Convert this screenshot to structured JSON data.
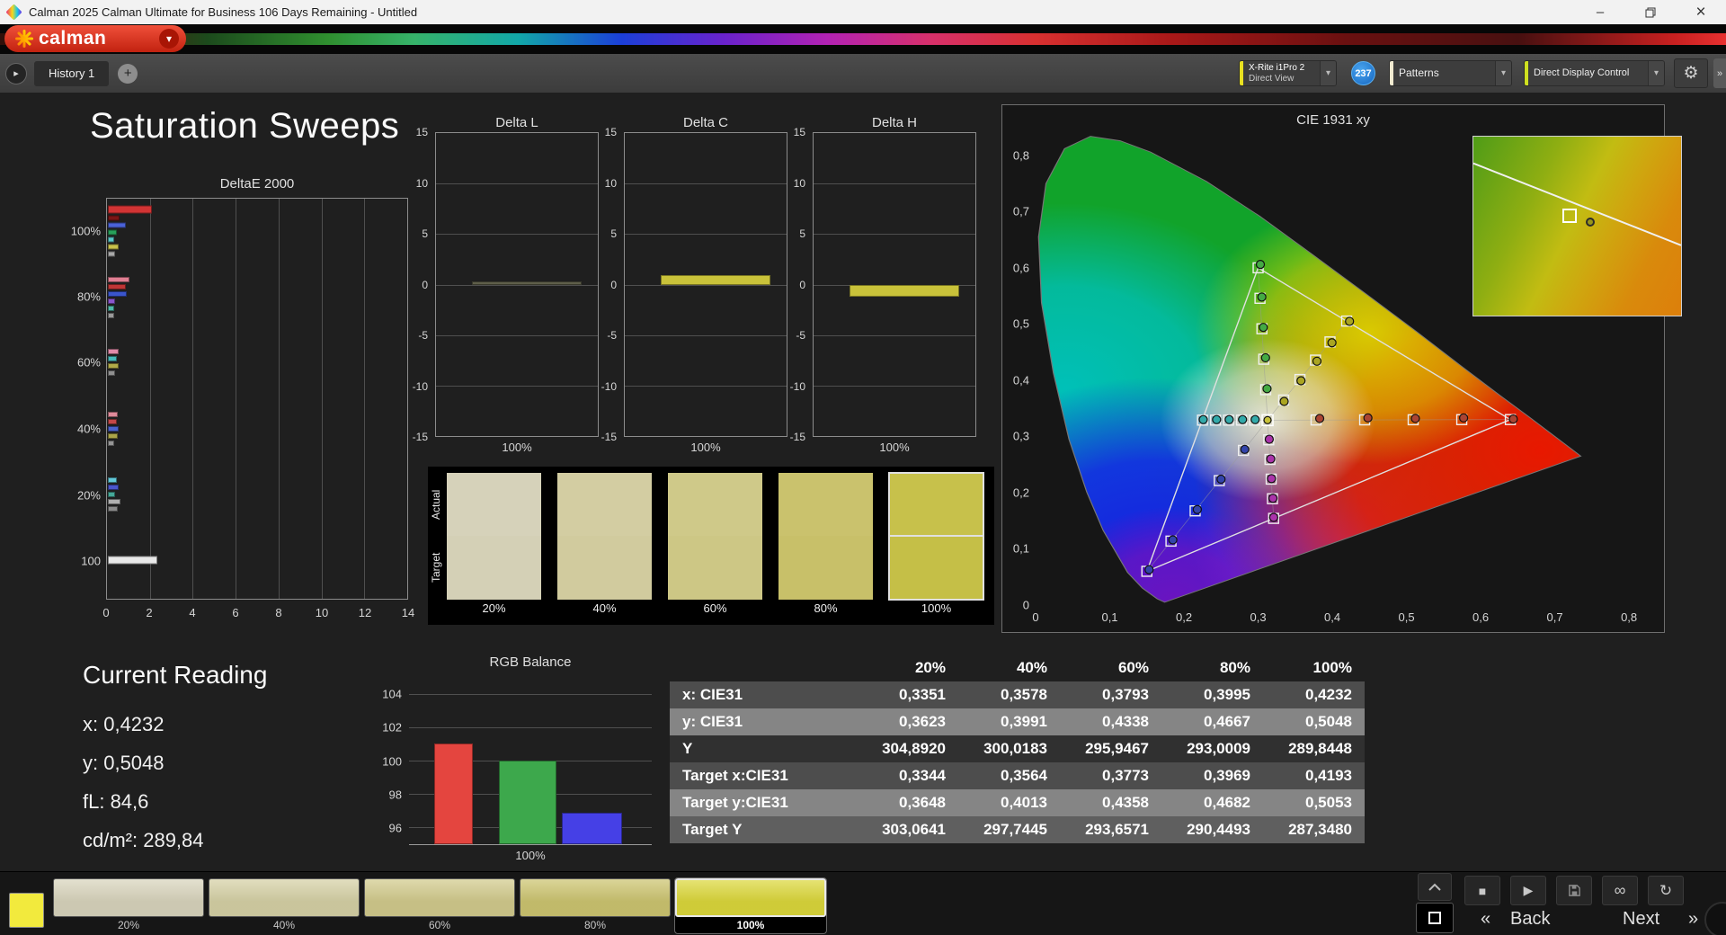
{
  "window": {
    "title": "Calman 2025 Calman Ultimate for Business 106 Days Remaining  - Untitled",
    "brand_logo": "calman"
  },
  "icons": {
    "minimize": "–",
    "close": "×",
    "dropdown_arrow": "▾",
    "tab_scroll": "▸",
    "add_tab": "+",
    "gear": "⚙",
    "edge_more": "»",
    "stop": "■",
    "play": "▶",
    "link": "∞",
    "refresh": "↻",
    "back_chevron": "«",
    "next_chevron": "»"
  },
  "workspace_tabs": {
    "active_tab": "History 1"
  },
  "toolbar": {
    "meter": {
      "line1": "X-Rite i1Pro 2",
      "line2": "Direct View"
    },
    "meter_badge": "237",
    "patterns_label": "Patterns",
    "display_control_label": "Direct Display Control"
  },
  "page": {
    "title": "Saturation Sweeps"
  },
  "current_reading": {
    "title": "Current Reading",
    "x": "x: 0,4232",
    "y": "y: 0,5048",
    "fl": "fL: 84,6",
    "cdm2": "cd/m²: 289,84"
  },
  "bottom_bar": {
    "active_color": "#f2ea3d",
    "swatches": [
      {
        "label": "20%",
        "color": "#d9d5bd"
      },
      {
        "label": "40%",
        "color": "#d6d1a6"
      },
      {
        "label": "60%",
        "color": "#d2cb8d"
      },
      {
        "label": "80%",
        "color": "#cdc571"
      },
      {
        "label": "100%",
        "color": "#dcd83c",
        "selected": true
      }
    ],
    "back_label": "Back",
    "next_label": "Next"
  },
  "chart_data": [
    {
      "id": "deltae2000",
      "type": "bar",
      "orientation": "horizontal",
      "title": "DeltaE 2000",
      "xlim": [
        0,
        14
      ],
      "x_ticks": [
        0,
        2,
        4,
        6,
        8,
        10,
        12,
        14
      ],
      "groups": [
        {
          "label": "100%",
          "center_pct": 8.2,
          "bars": [
            {
              "color": "#d23434",
              "value": 2.05,
              "thick": true
            },
            {
              "color": "#7a1515",
              "value": 0.55
            },
            {
              "color": "#4a62d8",
              "value": 0.85
            },
            {
              "color": "#27a05a",
              "value": 0.4
            },
            {
              "color": "#58c8c8",
              "value": 0.3
            },
            {
              "color": "#c8c24a",
              "value": 0.5
            },
            {
              "color": "#a8a8a8",
              "value": 0.35
            }
          ]
        },
        {
          "label": "80%",
          "center_pct": 24.7,
          "bars": [
            {
              "color": "#e07f92",
              "value": 1.0
            },
            {
              "color": "#c03535",
              "value": 0.85
            },
            {
              "color": "#3a55cc",
              "value": 0.9
            },
            {
              "color": "#8a55cc",
              "value": 0.35
            },
            {
              "color": "#4fb8a8",
              "value": 0.3
            },
            {
              "color": "#9a9a9a",
              "value": 0.3
            }
          ]
        },
        {
          "label": "60%",
          "center_pct": 41.0,
          "bars": [
            {
              "color": "#e08aa8",
              "value": 0.5
            },
            {
              "color": "#45b8b8",
              "value": 0.4
            },
            {
              "color": "#b0aa48",
              "value": 0.5
            },
            {
              "color": "#8f8f8f",
              "value": 0.35
            }
          ]
        },
        {
          "label": "40%",
          "center_pct": 57.5,
          "bars": [
            {
              "color": "#e08a9a",
              "value": 0.45
            },
            {
              "color": "#c44848",
              "value": 0.4
            },
            {
              "color": "#4a62cc",
              "value": 0.5
            },
            {
              "color": "#aaa448",
              "value": 0.45
            },
            {
              "color": "#959595",
              "value": 0.3
            }
          ]
        },
        {
          "label": "20%",
          "center_pct": 74.0,
          "bars": [
            {
              "color": "#62c8d8",
              "value": 0.4
            },
            {
              "color": "#4a55cc",
              "value": 0.5
            },
            {
              "color": "#45a898",
              "value": 0.35
            },
            {
              "color": "#b0b0b0",
              "value": 0.6
            },
            {
              "color": "#8a8a8a",
              "value": 0.45
            }
          ]
        },
        {
          "label": "100",
          "center_pct": 90.4,
          "bars": [
            {
              "color": "#e8e8e8",
              "value": 2.3,
              "thick": true
            }
          ]
        }
      ]
    },
    {
      "id": "delta_l",
      "type": "bar",
      "title": "Delta L",
      "ylim": [
        -15,
        15
      ],
      "y_ticks": [
        15,
        10,
        5,
        0,
        -5,
        -10,
        -15
      ],
      "xlabel": "100%",
      "value": 0.3,
      "color": "#5e5e4a"
    },
    {
      "id": "delta_c",
      "type": "bar",
      "title": "Delta C",
      "ylim": [
        -15,
        15
      ],
      "y_ticks": [
        15,
        10,
        5,
        0,
        -5,
        -10,
        -15
      ],
      "xlabel": "100%",
      "value": 0.9,
      "color": "#c9c23a"
    },
    {
      "id": "delta_h",
      "type": "bar",
      "title": "Delta H",
      "ylim": [
        -15,
        15
      ],
      "y_ticks": [
        15,
        10,
        5,
        0,
        -5,
        -10,
        -15
      ],
      "xlabel": "100%",
      "value": -1.2,
      "color": "#c9c23a"
    },
    {
      "id": "rgb_balance",
      "type": "bar",
      "title": "RGB Balance",
      "ylim": [
        95,
        105
      ],
      "y_ticks": [
        104,
        102,
        100,
        98,
        96
      ],
      "xlabel": "100%",
      "series": [
        {
          "name": "Red",
          "value": 101.0,
          "color": "#e4453f"
        },
        {
          "name": "Green",
          "value": 100.0,
          "color": "#3da84c"
        },
        {
          "name": "Blue",
          "value": 96.9,
          "color": "#4540e6"
        }
      ]
    },
    {
      "id": "cie1931",
      "type": "scatter",
      "title": "CIE 1931 xy",
      "xlim": [
        0,
        0.8
      ],
      "ylim": [
        0,
        0.8
      ],
      "axis_max": 0.835,
      "x_ticks": [
        {
          "v": 0,
          "label": "0"
        },
        {
          "v": 0.1,
          "label": "0,1"
        },
        {
          "v": 0.2,
          "label": "0,2"
        },
        {
          "v": 0.3,
          "label": "0,3"
        },
        {
          "v": 0.4,
          "label": "0,4"
        },
        {
          "v": 0.5,
          "label": "0,5"
        },
        {
          "v": 0.6,
          "label": "0,6"
        },
        {
          "v": 0.7,
          "label": "0,7"
        },
        {
          "v": 0.8,
          "label": "0,8"
        }
      ],
      "y_ticks": [
        {
          "v": 0,
          "label": "0"
        },
        {
          "v": 0.1,
          "label": "0,1"
        },
        {
          "v": 0.2,
          "label": "0,2"
        },
        {
          "v": 0.3,
          "label": "0,3"
        },
        {
          "v": 0.4,
          "label": "0,4"
        },
        {
          "v": 0.5,
          "label": "0,5"
        },
        {
          "v": 0.6,
          "label": "0,6"
        },
        {
          "v": 0.7,
          "label": "0,7"
        },
        {
          "v": 0.8,
          "label": "0,8"
        }
      ],
      "white_point": [
        0.3127,
        0.329
      ],
      "gamut_triangle": {
        "name": "Rec.709",
        "points": [
          [
            0.64,
            0.33
          ],
          [
            0.3,
            0.6
          ],
          [
            0.15,
            0.06
          ]
        ]
      },
      "sweeps": [
        {
          "name": "red",
          "color": "#aa4433",
          "targets": [
            [
              0.3781,
              0.3293
            ],
            [
              0.4436,
              0.3295
            ],
            [
              0.509,
              0.3297
            ],
            [
              0.5745,
              0.3299
            ],
            [
              0.64,
              0.33
            ]
          ],
          "measured": [
            [
              0.383,
              0.332
            ],
            [
              0.448,
              0.333
            ],
            [
              0.512,
              0.332
            ],
            [
              0.577,
              0.333
            ],
            [
              0.644,
              0.331
            ]
          ]
        },
        {
          "name": "green",
          "color": "#44aa44",
          "targets": [
            [
              0.3102,
              0.3832
            ],
            [
              0.3076,
              0.4374
            ],
            [
              0.3051,
              0.4916
            ],
            [
              0.3025,
              0.5458
            ],
            [
              0.3,
              0.6
            ]
          ],
          "measured": [
            [
              0.312,
              0.385
            ],
            [
              0.31,
              0.44
            ],
            [
              0.307,
              0.494
            ],
            [
              0.305,
              0.548
            ],
            [
              0.303,
              0.606
            ]
          ]
        },
        {
          "name": "blue",
          "color": "#3344aa",
          "targets": [
            [
              0.2802,
              0.2752
            ],
            [
              0.2476,
              0.2214
            ],
            [
              0.2151,
              0.1676
            ],
            [
              0.1825,
              0.1138
            ],
            [
              0.15,
              0.06
            ]
          ],
          "measured": [
            [
              0.282,
              0.277
            ],
            [
              0.25,
              0.224
            ],
            [
              0.218,
              0.17
            ],
            [
              0.185,
              0.116
            ],
            [
              0.153,
              0.063
            ]
          ]
        },
        {
          "name": "cyan",
          "color": "#33aaaa",
          "targets": [
            [
              0.2952,
              0.329
            ],
            [
              0.2777,
              0.329
            ],
            [
              0.2601,
              0.329
            ],
            [
              0.2426,
              0.329
            ],
            [
              0.225,
              0.329
            ]
          ],
          "measured": [
            [
              0.296,
              0.33
            ],
            [
              0.279,
              0.33
            ],
            [
              0.261,
              0.33
            ],
            [
              0.244,
              0.33
            ],
            [
              0.226,
              0.33
            ]
          ]
        },
        {
          "name": "magenta",
          "color": "#aa33aa",
          "targets": [
            [
              0.3143,
              0.294
            ],
            [
              0.316,
              0.2591
            ],
            [
              0.3176,
              0.2241
            ],
            [
              0.3193,
              0.1892
            ],
            [
              0.3209,
              0.1542
            ]
          ],
          "measured": [
            [
              0.315,
              0.295
            ],
            [
              0.317,
              0.26
            ],
            [
              0.318,
              0.225
            ],
            [
              0.32,
              0.19
            ],
            [
              0.321,
              0.156
            ]
          ]
        },
        {
          "name": "yellow",
          "color": "#aaa522",
          "targets": [
            [
              0.3344,
              0.3648
            ],
            [
              0.3564,
              0.4013
            ],
            [
              0.3773,
              0.4358
            ],
            [
              0.3969,
              0.4682
            ],
            [
              0.4193,
              0.5053
            ]
          ],
          "measured": [
            [
              0.3351,
              0.3623
            ],
            [
              0.3578,
              0.3991
            ],
            [
              0.3793,
              0.4338
            ],
            [
              0.3995,
              0.4667
            ],
            [
              0.4232,
              0.5048
            ]
          ]
        }
      ]
    },
    {
      "id": "saturation_table",
      "type": "table",
      "columns": [
        "",
        "20%",
        "40%",
        "60%",
        "80%",
        "100%"
      ],
      "rows": [
        {
          "label": "x: CIE31",
          "values": [
            "0,3351",
            "0,3578",
            "0,3793",
            "0,3995",
            "0,4232"
          ]
        },
        {
          "label": "y: CIE31",
          "values": [
            "0,3623",
            "0,3991",
            "0,4338",
            "0,4667",
            "0,5048"
          ]
        },
        {
          "label": "Y",
          "values": [
            "304,8920",
            "300,0183",
            "295,9467",
            "293,0009",
            "289,8448"
          ]
        },
        {
          "label": "Target x:CIE31",
          "values": [
            "0,3344",
            "0,3564",
            "0,3773",
            "0,3969",
            "0,4193"
          ]
        },
        {
          "label": "Target y:CIE31",
          "values": [
            "0,3648",
            "0,4013",
            "0,4358",
            "0,4682",
            "0,5053"
          ]
        },
        {
          "label": "Target Y",
          "values": [
            "303,0641",
            "297,7445",
            "293,6571",
            "290,4493",
            "287,3480"
          ]
        }
      ]
    },
    {
      "id": "swatch_compare",
      "type": "swatches",
      "row_labels": [
        "Actual",
        "Target"
      ],
      "columns": [
        {
          "label": "20%",
          "actual": "#d6d2ba",
          "target": "#d4d0b6"
        },
        {
          "label": "40%",
          "actual": "#d3cda2",
          "target": "#d1cb9e"
        },
        {
          "label": "60%",
          "actual": "#cfc989",
          "target": "#cdc785"
        },
        {
          "label": "80%",
          "actual": "#cac26d",
          "target": "#c8c069"
        },
        {
          "label": "100%",
          "actual": "#c7c14b",
          "target": "#c5bf47",
          "selected": true
        }
      ]
    }
  ]
}
